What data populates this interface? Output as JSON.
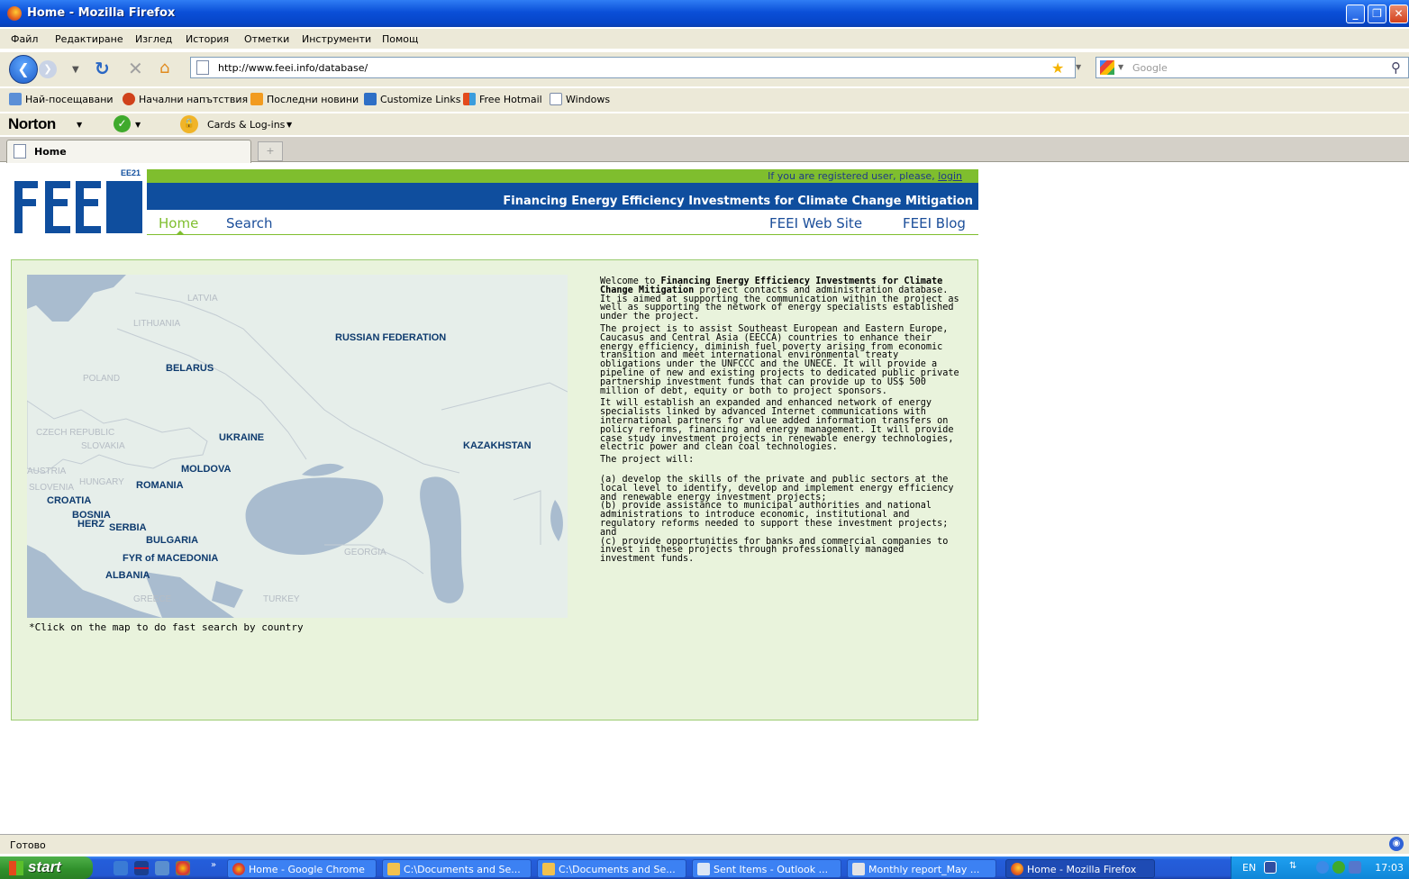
{
  "window": {
    "title": "Home - Mozilla Firefox"
  },
  "menu": [
    "Файл",
    "Редактиране",
    "Изглед",
    "История",
    "Отметки",
    "Инструменти",
    "Помощ"
  ],
  "nav": {
    "url": "http://www.feei.info/database/",
    "search_placeholder": "Google"
  },
  "bookmarks": [
    "Най-посещавани",
    "Начални напътствия",
    "Последни новини",
    "Customize Links",
    "Free Hotmail",
    "Windows"
  ],
  "norton": {
    "brand": "Norton",
    "cards": "Cards & Log-ins"
  },
  "tab": {
    "title": "Home"
  },
  "site": {
    "login_prompt": "If you are registered user, please,",
    "login_link": "login",
    "logo_badge": "EE21",
    "tagline": "Financing Energy Efficiency Investments for Climate Change Mitigation",
    "nav_home": "Home",
    "nav_search": "Search",
    "nav_website": "FEEI Web Site",
    "nav_blog": "FEEI Blog"
  },
  "map": {
    "countries": [
      "RUSSIAN FEDERATION",
      "BELARUS",
      "UKRAINE",
      "KAZAKHSTAN",
      "MOLDOVA",
      "ROMANIA",
      "CROATIA",
      "BOSNIA",
      "HERZ",
      "SERBIA",
      "BULGARIA",
      "FYR of MACEDONIA",
      "ALBANIA"
    ],
    "ghost_labels": [
      "LATVIA",
      "LITHUANIA",
      "POLAND",
      "CZECH REPUBLIC",
      "SLOVAKIA",
      "AUSTRIA",
      "HUNGARY",
      "SLOVENIA",
      "GREECE",
      "TURKEY",
      "GEORGIA"
    ],
    "note": "*Click on the map to do fast search by country"
  },
  "welcome": {
    "p1_pre": "Welcome to ",
    "p1_bold": "Financing Energy Efficiency Investments for Climate Change Mitigation",
    "p1_post": " project contacts and administration database. It is aimed at supporting the communication within the project as well as supporting the network of energy specialists established under the project.",
    "p2": "The project is to assist Southeast European and Eastern Europe, Caucasus and Central Asia (EECCA) countries to enhance their energy efficiency, diminish fuel poverty arising from economic transition and meet international environmental treaty obligations under the UNFCCC and the UNECE. It will provide a pipeline of new and existing projects to dedicated public private partnership investment funds that can provide up to US$ 500 million of debt, equity or both to project sponsors.",
    "p3": "It will establish an expanded and enhanced network of energy specialists linked by advanced Internet communications with international partners for value added information transfers on policy reforms, financing and energy management. It will provide case study investment projects in renewable energy technologies, electric power and clean coal technologies.",
    "p4": "The project will:",
    "item_a": "(a) develop the skills of the private and public sectors at the local level to identify, develop and implement energy efficiency and renewable energy investment projects;",
    "item_b": "(b) provide assistance to municipal authorities and national administrations to introduce economic, institutional and regulatory reforms needed to support these investment projects; and",
    "item_c": "(c) provide opportunities for banks and commercial companies to invest in these projects through professionally managed investment funds."
  },
  "status": {
    "text": "Готово"
  },
  "taskbar": {
    "start": "start",
    "tasks": [
      "Home - Google Chrome",
      "C:\\Documents and Se...",
      "C:\\Documents and Se...",
      "Sent Items - Outlook ...",
      "Monthly report_May ...",
      "Home - Mozilla Firefox"
    ],
    "lang": "EN",
    "clock": "17:03"
  }
}
